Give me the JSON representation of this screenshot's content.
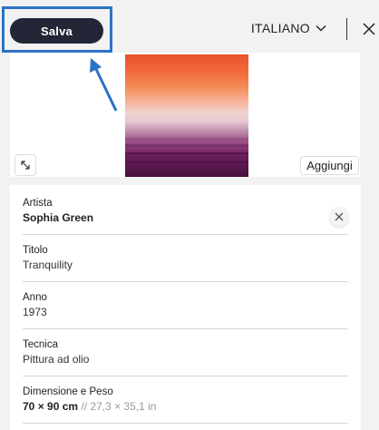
{
  "header": {
    "save_label": "Salva",
    "language": "ITALIANO"
  },
  "image_card": {
    "add_label": "Aggiungi"
  },
  "details": {
    "fields": [
      {
        "label": "Artista",
        "value": "Sophia Green"
      },
      {
        "label": "Titolo",
        "value": "Tranquility"
      },
      {
        "label": "Anno",
        "value": "1973"
      },
      {
        "label": "Tecnica",
        "value": "Pittura ad olio"
      },
      {
        "label": "Dimensione e Peso",
        "value": "70 × 90 cm",
        "secondary": " // 27,3 × 35,1 in"
      }
    ]
  },
  "colors": {
    "highlight": "#2a73c6",
    "save_button_bg": "#222636"
  },
  "icons": [
    "chevron-down-icon",
    "close-icon",
    "expand-icon",
    "clear-icon",
    "annotation-arrow"
  ]
}
